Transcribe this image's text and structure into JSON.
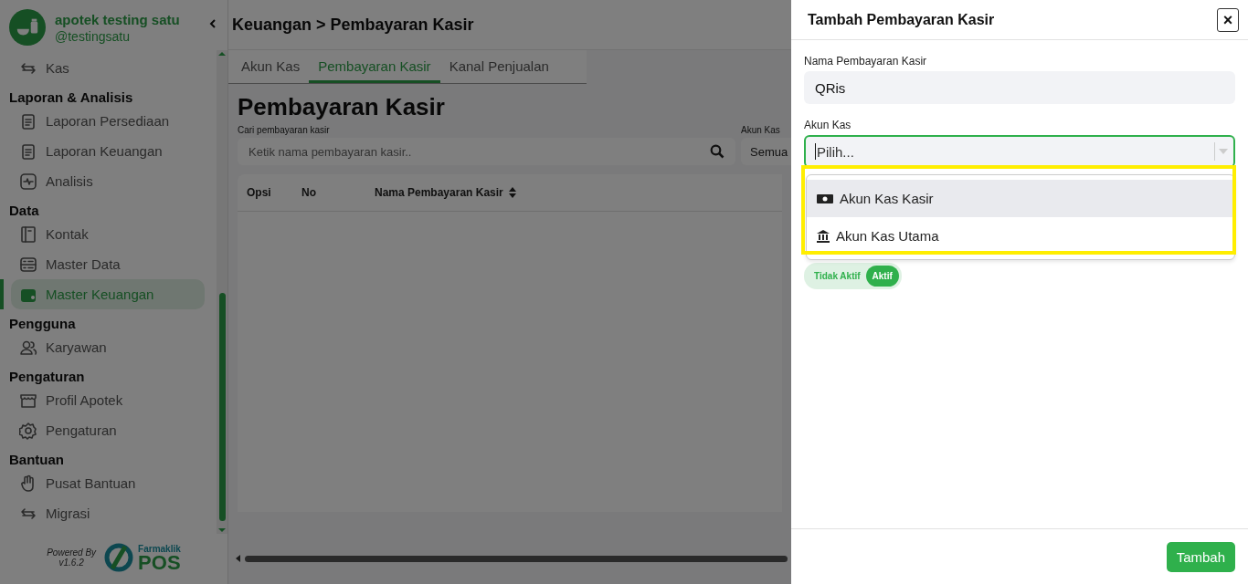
{
  "sidebar": {
    "store_name": "apotek testing satu",
    "handle": "@testingsatu",
    "sections": [
      {
        "items": [
          {
            "label": "Kas",
            "selected": false
          }
        ]
      },
      {
        "title": "Laporan & Analisis",
        "items": [
          {
            "label": "Laporan Persediaan",
            "selected": false
          },
          {
            "label": "Laporan Keuangan",
            "selected": false
          },
          {
            "label": "Analisis",
            "selected": false
          }
        ]
      },
      {
        "title": "Data",
        "items": [
          {
            "label": "Kontak",
            "selected": false
          },
          {
            "label": "Master Data",
            "selected": false
          },
          {
            "label": "Master Keuangan",
            "selected": true
          }
        ]
      },
      {
        "title": "Pengguna",
        "items": [
          {
            "label": "Karyawan",
            "selected": false
          }
        ]
      },
      {
        "title": "Pengaturan",
        "items": [
          {
            "label": "Profil Apotek",
            "selected": false
          },
          {
            "label": "Pengaturan",
            "selected": false
          }
        ]
      },
      {
        "title": "Bantuan",
        "items": [
          {
            "label": "Pusat Bantuan",
            "selected": false
          },
          {
            "label": "Migrasi",
            "selected": false
          }
        ]
      }
    ],
    "footer": {
      "powered_by": "Powered By",
      "version": "v1.6.2",
      "brand": "Farmaklik",
      "product": "POS"
    }
  },
  "main": {
    "breadcrumb": "Keuangan > Pembayaran Kasir",
    "tabs": [
      {
        "label": "Akun Kas",
        "selected": false
      },
      {
        "label": "Pembayaran Kasir",
        "selected": true
      },
      {
        "label": "Kanal Penjualan",
        "selected": false
      }
    ],
    "title": "Pembayaran Kasir",
    "search": {
      "label": "Cari pembayaran kasir",
      "placeholder": "Ketik nama pembayaran kasir.."
    },
    "filter": {
      "label": "Akun Kas",
      "value": "Semua"
    },
    "table": {
      "columns": [
        {
          "label": "Opsi",
          "sortable": false
        },
        {
          "label": "No",
          "sortable": false
        },
        {
          "label": "Nama Pembayaran Kasir",
          "sortable": true
        }
      ]
    }
  },
  "drawer": {
    "title": "Tambah Pembayaran Kasir",
    "close": "×",
    "name_field": {
      "label": "Nama Pembayaran Kasir",
      "value": "QRis"
    },
    "account_field": {
      "label": "Akun Kas",
      "placeholder": "Pilih...",
      "expanded": true,
      "options": [
        {
          "label": "Akun Kas Kasir",
          "selected": true
        },
        {
          "label": "Akun Kas Utama",
          "selected": false
        }
      ]
    },
    "status_toggle": {
      "off_label": "Tidak Aktif",
      "on_label": "Aktif",
      "on": true
    },
    "submit": "Tambah"
  }
}
